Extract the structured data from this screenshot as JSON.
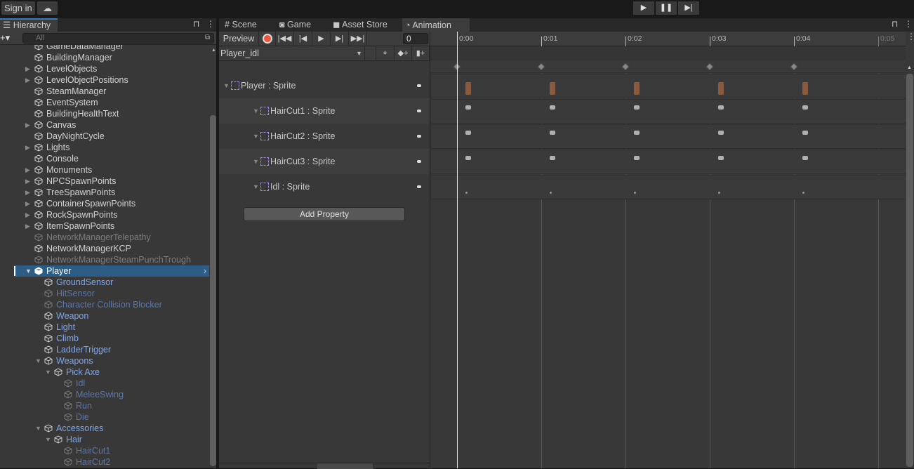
{
  "topbar": {
    "sign_in": "Sign in",
    "cloud_icon": "cloud-icon",
    "play_icon": "play-icon",
    "pause_icon": "pause-icon",
    "step_icon": "step-icon"
  },
  "hierarchy": {
    "tab_label": "Hierarchy",
    "search_placeholder": "All",
    "items": [
      {
        "name": "GameDataManager",
        "depth": 0,
        "arrow": "none",
        "style": "normal"
      },
      {
        "name": "BuildingManager",
        "depth": 0,
        "arrow": "none",
        "style": "normal"
      },
      {
        "name": "LevelObjects",
        "depth": 0,
        "arrow": "collapsed",
        "style": "normal"
      },
      {
        "name": "LevelObjectPositions",
        "depth": 0,
        "arrow": "collapsed",
        "style": "normal"
      },
      {
        "name": "SteamManager",
        "depth": 0,
        "arrow": "none",
        "style": "normal"
      },
      {
        "name": "EventSystem",
        "depth": 0,
        "arrow": "none",
        "style": "normal"
      },
      {
        "name": "BuildingHealthText",
        "depth": 0,
        "arrow": "none",
        "style": "normal"
      },
      {
        "name": "Canvas",
        "depth": 0,
        "arrow": "collapsed",
        "style": "normal"
      },
      {
        "name": "DayNightCycle",
        "depth": 0,
        "arrow": "none",
        "style": "normal"
      },
      {
        "name": "Lights",
        "depth": 0,
        "arrow": "collapsed",
        "style": "normal"
      },
      {
        "name": "Console",
        "depth": 0,
        "arrow": "none",
        "style": "normal"
      },
      {
        "name": "Monuments",
        "depth": 0,
        "arrow": "collapsed",
        "style": "normal"
      },
      {
        "name": "NPCSpawnPoints",
        "depth": 0,
        "arrow": "collapsed",
        "style": "normal"
      },
      {
        "name": "TreeSpawnPoints",
        "depth": 0,
        "arrow": "collapsed",
        "style": "normal"
      },
      {
        "name": "ContainerSpawnPoints",
        "depth": 0,
        "arrow": "collapsed",
        "style": "normal"
      },
      {
        "name": "RockSpawnPoints",
        "depth": 0,
        "arrow": "collapsed",
        "style": "normal"
      },
      {
        "name": "ItemSpawnPoints",
        "depth": 0,
        "arrow": "collapsed",
        "style": "normal"
      },
      {
        "name": "NetworkManagerTelepathy",
        "depth": 0,
        "arrow": "none",
        "style": "inactive"
      },
      {
        "name": "NetworkManagerKCP",
        "depth": 0,
        "arrow": "none",
        "style": "normal"
      },
      {
        "name": "NetworkManagerSteamPunchTrough",
        "depth": 0,
        "arrow": "none",
        "style": "inactive"
      },
      {
        "name": "Player",
        "depth": 0,
        "arrow": "expanded",
        "style": "selected"
      },
      {
        "name": "GroundSensor",
        "depth": 1,
        "arrow": "none",
        "style": "prefab"
      },
      {
        "name": "HitSensor",
        "depth": 1,
        "arrow": "none",
        "style": "prefab-inactive"
      },
      {
        "name": "Character Collision Blocker",
        "depth": 1,
        "arrow": "none",
        "style": "prefab-inactive"
      },
      {
        "name": "Weapon",
        "depth": 1,
        "arrow": "none",
        "style": "prefab"
      },
      {
        "name": "Light",
        "depth": 1,
        "arrow": "none",
        "style": "prefab"
      },
      {
        "name": "Climb",
        "depth": 1,
        "arrow": "none",
        "style": "prefab"
      },
      {
        "name": "LadderTrigger",
        "depth": 1,
        "arrow": "none",
        "style": "prefab"
      },
      {
        "name": "Weapons",
        "depth": 1,
        "arrow": "expanded",
        "style": "prefab"
      },
      {
        "name": "Pick Axe",
        "depth": 2,
        "arrow": "expanded",
        "style": "prefab"
      },
      {
        "name": "Idl",
        "depth": 3,
        "arrow": "none",
        "style": "prefab-inactive"
      },
      {
        "name": "MeleeSwing",
        "depth": 3,
        "arrow": "none",
        "style": "prefab-inactive"
      },
      {
        "name": "Run",
        "depth": 3,
        "arrow": "none",
        "style": "prefab-inactive"
      },
      {
        "name": "Die",
        "depth": 3,
        "arrow": "none",
        "style": "prefab-inactive"
      },
      {
        "name": "Accessories",
        "depth": 1,
        "arrow": "expanded",
        "style": "prefab"
      },
      {
        "name": "Hair",
        "depth": 2,
        "arrow": "expanded",
        "style": "prefab"
      },
      {
        "name": "HairCut1",
        "depth": 3,
        "arrow": "none",
        "style": "prefab-inactive"
      },
      {
        "name": "HairCut2",
        "depth": 3,
        "arrow": "none",
        "style": "prefab-inactive"
      }
    ]
  },
  "animation": {
    "tabs": [
      {
        "label": "Scene",
        "icon": "grid-icon"
      },
      {
        "label": "Game",
        "icon": "gamepad-icon"
      },
      {
        "label": "Asset Store",
        "icon": "bag-icon"
      },
      {
        "label": "Animation",
        "icon": "clock-icon"
      }
    ],
    "preview_label": "Preview",
    "frame_value": "0",
    "clip_name": "Player_idl",
    "ruler_labels": [
      "0:00",
      "0:01",
      "0:02",
      "0:03",
      "0:04",
      "0:05"
    ],
    "keyframe_seconds": [
      0,
      1,
      2,
      3,
      4
    ],
    "properties": [
      {
        "label": "Player : Sprite",
        "indent": 0,
        "sprite_color": "#8a5a3e"
      },
      {
        "label": "HairCut1 : Sprite",
        "indent": 1,
        "sprite_color": "#b0b0b0"
      },
      {
        "label": "HairCut2 : Sprite",
        "indent": 1,
        "sprite_color": "#b0b0b0"
      },
      {
        "label": "HairCut3 : Sprite",
        "indent": 1,
        "sprite_color": "#b0b0b0"
      },
      {
        "label": "Idl : Sprite",
        "indent": 1,
        "sprite_color": "#999999"
      }
    ],
    "add_property": "Add Property"
  },
  "colors": {
    "selection": "#2c5d87",
    "prefab": "#7ca7f0",
    "prefab_inactive": "#5a78ad",
    "inactive": "#7d7d7d",
    "record": "#f0563a"
  }
}
